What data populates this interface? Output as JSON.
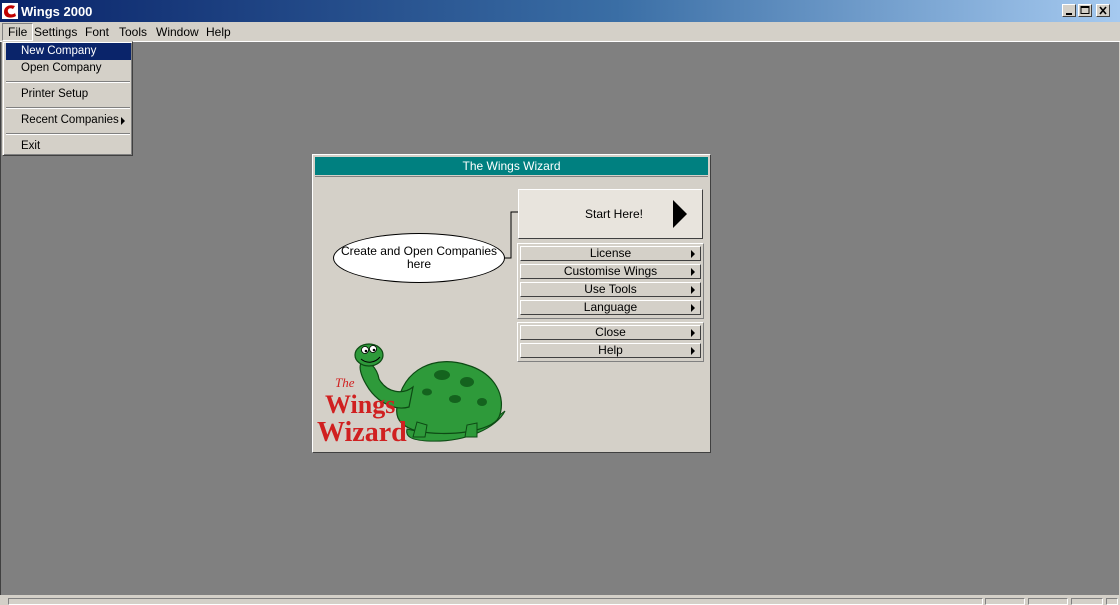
{
  "window": {
    "title": "Wings 2000",
    "icon": "wings-app-icon",
    "controls": [
      "minimize-icon",
      "maximize-icon",
      "close-icon"
    ]
  },
  "menubar": {
    "items": [
      "File",
      "Settings",
      "Font",
      "Tools",
      "Window",
      "Help"
    ],
    "open_menu": "File"
  },
  "file_menu": {
    "items": [
      "New Company",
      "Open Company",
      "Printer Setup",
      "Recent Companies",
      "Exit"
    ],
    "selected": "New Company"
  },
  "wizard": {
    "title": "The Wings Wizard",
    "start_label": "Start Here!",
    "bubble_text": "Create and Open Companies here",
    "buttons_group1": [
      "License",
      "Customise Wings",
      "Use Tools",
      "Language"
    ],
    "buttons_group2": [
      "Close",
      "Help"
    ],
    "logo_text": {
      "line1": "The",
      "line2": "Wings",
      "line3": "Wizard"
    },
    "colors": {
      "title_bar": "#008080",
      "logo_red": "#d02020",
      "dino_green": "#2e9a3a"
    }
  }
}
